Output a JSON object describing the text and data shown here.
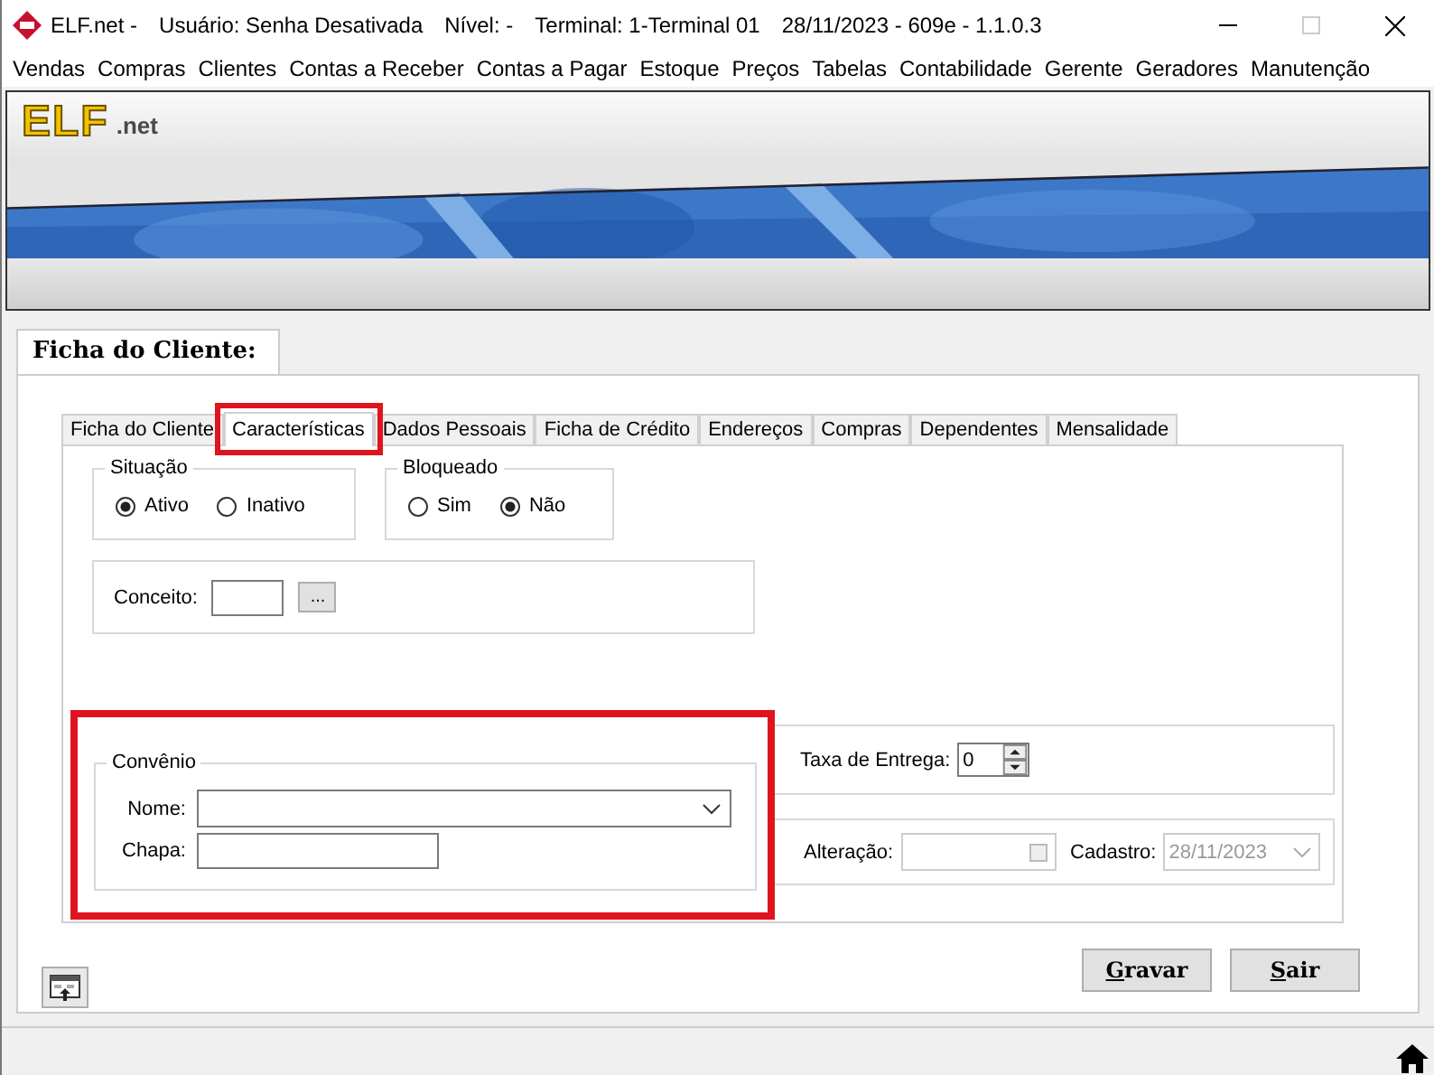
{
  "window": {
    "title_parts": [
      "ELF.net -",
      "Usuário: Senha Desativada",
      "Nível: -",
      "Terminal: 1-Terminal 01",
      "28/11/2023 - 609e - 1.1.0.3"
    ],
    "maximize_disabled": true
  },
  "menu": [
    "Vendas",
    "Compras",
    "Clientes",
    "Contas a Receber",
    "Contas a Pagar",
    "Estoque",
    "Preços",
    "Tabelas",
    "Contabilidade",
    "Gerente",
    "Geradores",
    "Manutenção"
  ],
  "banner": {
    "logo": "ELF",
    "logo_suffix": ".net"
  },
  "form": {
    "title": "Ficha do Cliente:"
  },
  "tabs": [
    {
      "label": "Ficha do Cliente",
      "selected": false,
      "highlighted": false
    },
    {
      "label": "Características",
      "selected": true,
      "highlighted": true
    },
    {
      "label": "Dados Pessoais",
      "selected": false,
      "highlighted": false
    },
    {
      "label": "Ficha de Crédito",
      "selected": false,
      "highlighted": false
    },
    {
      "label": "Endereços",
      "selected": false,
      "highlighted": false
    },
    {
      "label": "Compras",
      "selected": false,
      "highlighted": false
    },
    {
      "label": "Dependentes",
      "selected": false,
      "highlighted": false
    },
    {
      "label": "Mensalidade",
      "selected": false,
      "highlighted": false
    }
  ],
  "radio_groups": [
    {
      "title": "Situação",
      "options": [
        {
          "label": "Ativo",
          "selected": true
        },
        {
          "label": "Inativo",
          "selected": false
        }
      ]
    },
    {
      "title": "Bloqueado",
      "options": [
        {
          "label": "Sim",
          "selected": false
        },
        {
          "label": "Não",
          "selected": true
        }
      ]
    }
  ],
  "conceito": {
    "label": "Conceito:",
    "button": "..."
  },
  "convenio": {
    "title": "Convênio",
    "highlighted": true,
    "fields": [
      {
        "label": "Nome:",
        "kind": "dropdown"
      },
      {
        "label": "Chapa:",
        "kind": "text"
      }
    ]
  },
  "taxa": {
    "label": "Taxa de Entrega:",
    "value": "0"
  },
  "alteracao": {
    "label": "Alteração:",
    "disabled": true
  },
  "cadastro": {
    "label": "Cadastro:",
    "value": "28/11/2023",
    "disabled": true
  },
  "buttons": [
    {
      "label": "Gravar"
    },
    {
      "label": "Sair"
    }
  ]
}
